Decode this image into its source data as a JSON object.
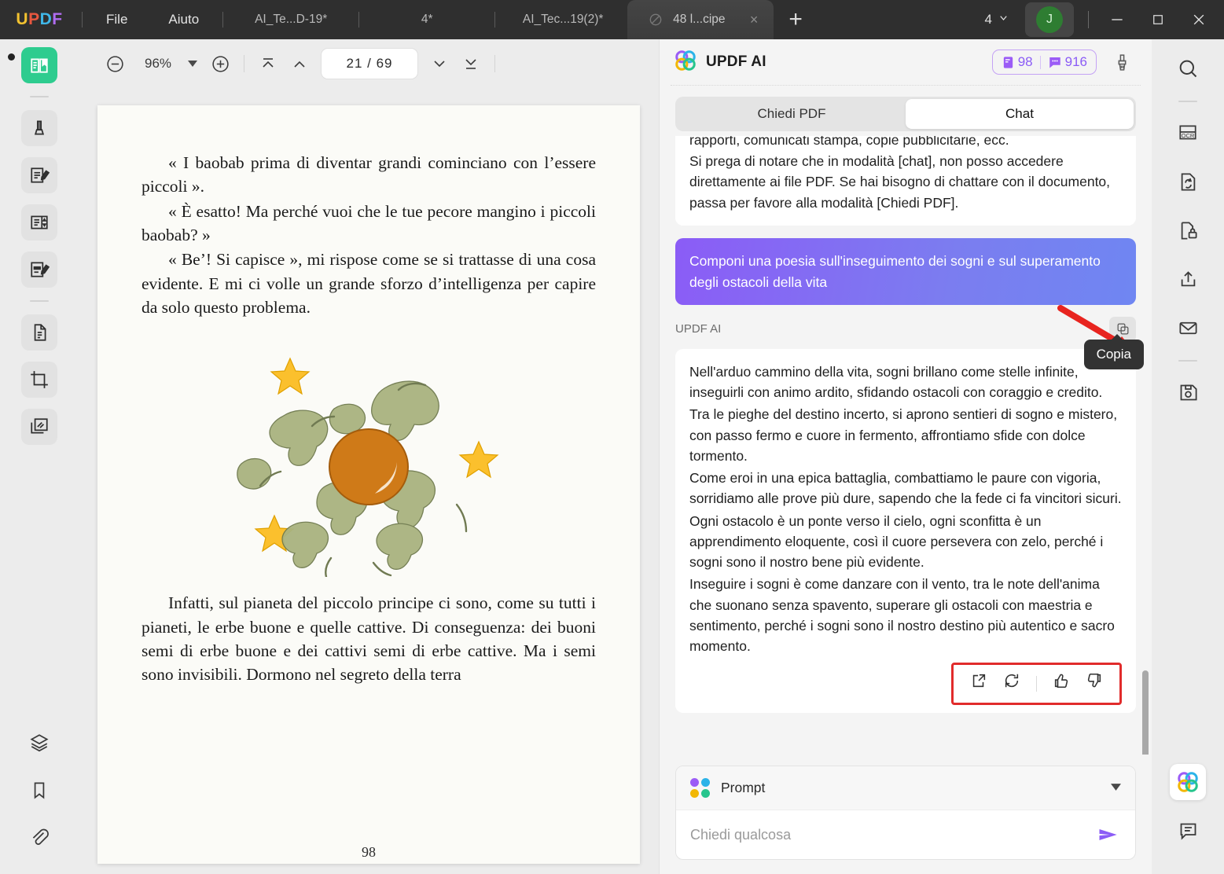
{
  "titlebar": {
    "logo": "UPDF",
    "menus": [
      "File",
      "Aiuto"
    ],
    "tabs": [
      {
        "label": "AI_Te...D-19*",
        "active": false
      },
      {
        "label": "4*",
        "active": false
      },
      {
        "label": "AI_Tec...19(2)*",
        "active": false
      },
      {
        "label": "48 l...cipe",
        "active": true
      }
    ],
    "new_tab_label": "+",
    "tab_count": "4",
    "avatar_initial": "J",
    "close_tab_label": "×"
  },
  "left_rail": {
    "items": [
      {
        "name": "reader-mode",
        "active": true
      },
      {
        "name": "highlight-tool",
        "active": false
      },
      {
        "name": "edit-text-tool",
        "active": false
      },
      {
        "name": "page-layout-tool",
        "active": false
      },
      {
        "name": "form-edit-tool",
        "active": false
      },
      {
        "name": "organize-pages-tool",
        "active": false
      },
      {
        "name": "crop-tool",
        "active": false
      },
      {
        "name": "batch-tool",
        "active": false
      }
    ],
    "bottom_items": [
      "layers",
      "bookmark",
      "attachment"
    ]
  },
  "right_rail": {
    "items": [
      "search",
      "ocr",
      "convert",
      "protect",
      "share",
      "email",
      "save"
    ],
    "bottom_items": [
      "updf-ai",
      "comment"
    ]
  },
  "pdf_toolbar": {
    "zoom_out": "−",
    "zoom_value": "96%",
    "zoom_in": "+",
    "page_value": "21 / 69",
    "page_separator": "/",
    "current_page": "21",
    "total_pages": "69"
  },
  "pdf_page": {
    "paragraphs": [
      "« I baobab prima di diventar grandi cominciano con l’essere piccoli ».",
      "« È esatto! Ma perché vuoi che le tue pecore mangino i piccoli baobab? »",
      "« Be’! Si capisce », mi rispose come se si trattasse di una cosa evidente. E mi ci volle un grande sforzo d’intelligenza per capire da solo questo problema."
    ],
    "paragraph_after": "Infatti, sul pianeta del piccolo principe ci sono, come su tutti i pianeti, le erbe buone e quelle cattive. Di conseguenza: dei buoni semi di erbe buone e dei cattivi semi di erbe cattive. Ma i semi sono invisibili. Dormono nel segreto della terra",
    "page_number": "98"
  },
  "ai_panel": {
    "title": "UPDF AI",
    "credits": {
      "documents": "98",
      "messages": "916"
    },
    "tabs": [
      {
        "label": "Chiedi PDF",
        "active": false
      },
      {
        "label": "Chat",
        "active": true
      }
    ],
    "messages": [
      {
        "role": "assistant",
        "clipped_line": "rapporti, comunicati stampa, copie pubblicitarie, ecc.",
        "text": "Si prega di notare che in modalità [chat], non posso accedere direttamente ai file PDF. Se hai bisogno di chattare con il documento, passa per favore alla modalità [Chiedi PDF]."
      },
      {
        "role": "user",
        "text": "Componi una poesia sull'inseguimento dei sogni e sul superamento degli ostacoli della vita"
      }
    ],
    "answer_author": "UPDF AI",
    "copy_tooltip": "Copia",
    "answer_paragraphs": [
      "Nell'arduo cammino della vita, sogni brillano come stelle infinite, inseguirli con animo ardito, sfidando ostacoli con coraggio e credito.",
      "Tra le pieghe del destino incerto, si aprono sentieri di sogno e mistero, con passo fermo e cuore in fermento, affrontiamo sfide con dolce tormento.",
      "Come eroi in una epica battaglia, combattiamo le paure con vigoria, sorridiamo alle prove più dure, sapendo che la fede ci fa vincitori sicuri.",
      "Ogni ostacolo è un ponte verso il cielo, ogni sconfitta è un apprendimento eloquente, così il cuore persevera con zelo, perché i sogni sono il nostro bene più evidente.",
      "Inseguire i sogni è come danzare con il vento, tra le note dell'anima che suonano senza spavento, superare gli ostacoli con maestria e sentimento, perché i sogni sono il nostro destino più autentico e sacro momento."
    ],
    "answer_actions": [
      "export",
      "regenerate",
      "thumbs-up",
      "thumbs-down"
    ],
    "composer": {
      "prompt_label": "Prompt",
      "input_placeholder": "Chiedi qualcosa",
      "input_value": ""
    }
  },
  "colors": {
    "accent_purple": "#8b5cf6",
    "active_green": "#2ecc8f",
    "annotation_red": "#e12b2b",
    "titlebar_bg": "#2f2f2f",
    "panel_bg": "#f4f4f4"
  }
}
